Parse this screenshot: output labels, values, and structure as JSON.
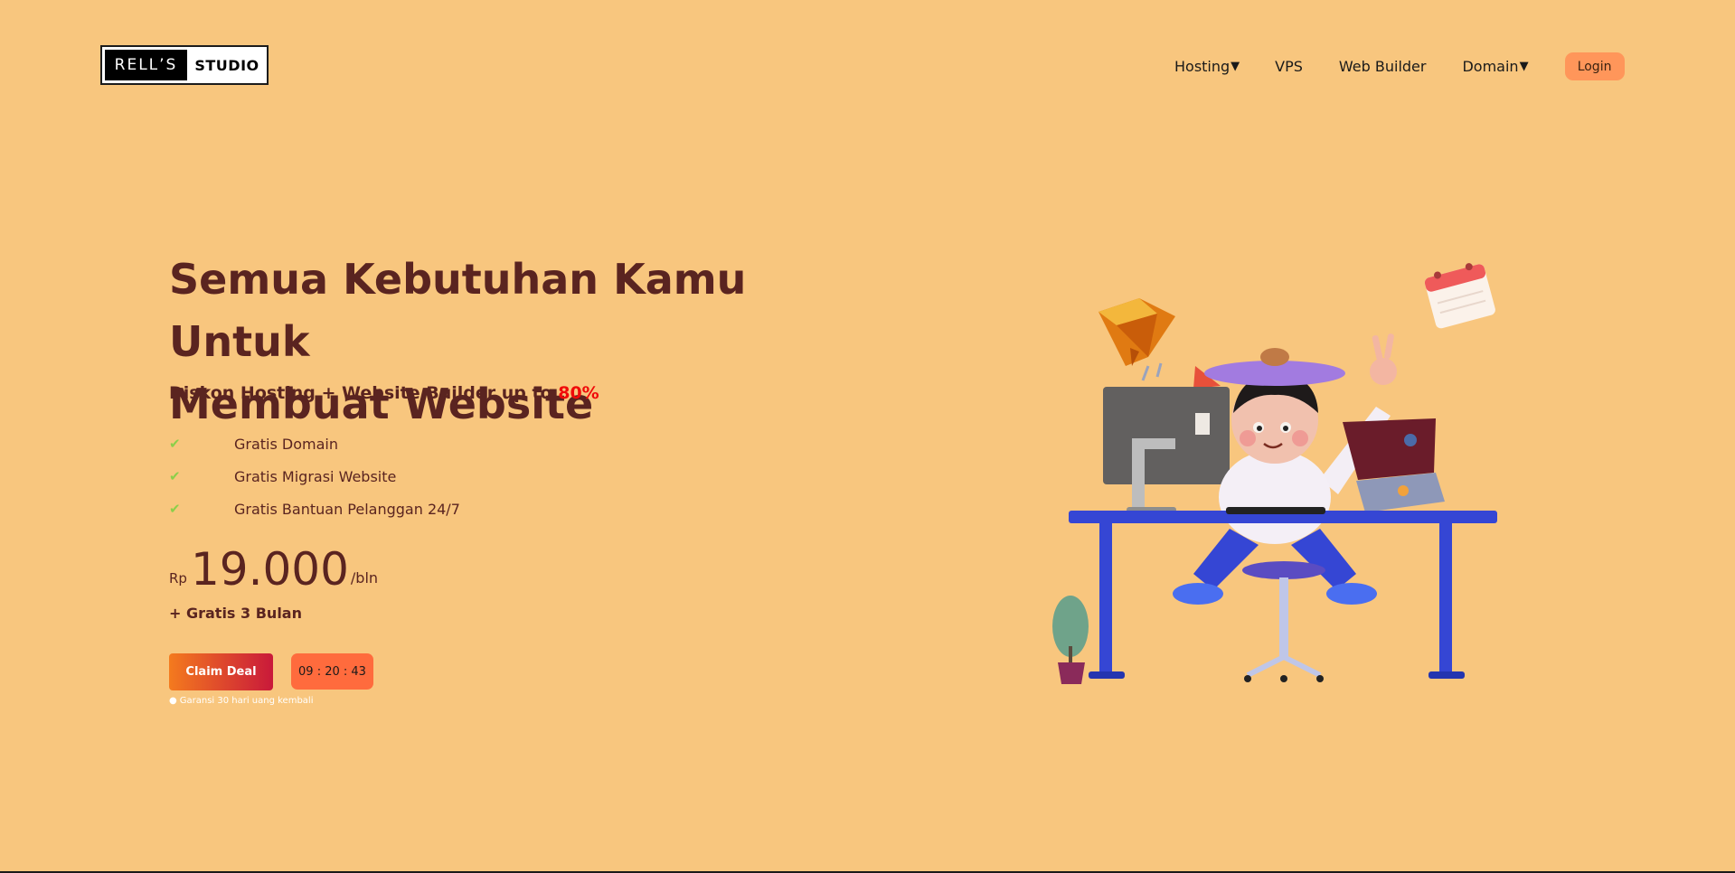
{
  "logo": {
    "left_text": "RELL’S",
    "right_text": "STUDIO"
  },
  "nav": {
    "hosting": "Hosting",
    "vps": "VPS",
    "web_builder": "Web Builder",
    "domain": "Domain",
    "login": "Login"
  },
  "hero": {
    "title_line1": "Semua Kebutuhan Kamu Untuk",
    "title_line2": "Membuat Website",
    "subtitle": "Diskon Hosting + Website Builder up to ",
    "discount": "80%",
    "features": [
      "Gratis Domain",
      "Gratis Migrasi Website",
      "Gratis Bantuan Pelanggan 24/7"
    ],
    "currency": "Rp",
    "price": "19.000",
    "per": "/bln",
    "bonus": "+ Gratis 3 Bulan",
    "claim_label": "Claim Deal",
    "timer": "09 : 20 : 43",
    "guarantee": "Garansi 30 hari uang kembali"
  },
  "colors": {
    "background": "#f8c67e",
    "heading": "#5a2420",
    "accent_red": "#f00a0a",
    "login_bg": "#ff965a",
    "timer_bg": "#ff6b3d",
    "check": "#8ccf4a",
    "illustration_desk": "#3546d4"
  },
  "icons": {
    "caret": "caret-down-icon",
    "check": "check-icon",
    "pin": "location-pin-icon"
  }
}
